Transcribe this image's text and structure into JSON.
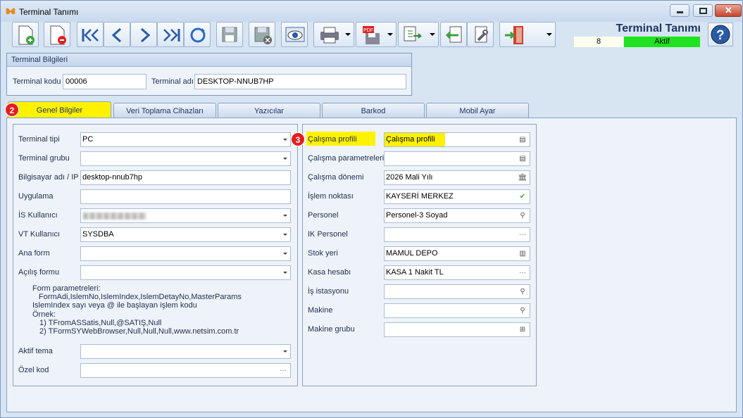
{
  "window": {
    "title": "Terminal Tanımı"
  },
  "header": {
    "title": "Terminal Tanımı",
    "record_number": "8",
    "status": "Aktif",
    "status_color": "#1ee31e"
  },
  "toolbar": {
    "buttons": [
      "new-document-icon",
      "delete-document-icon",
      "first-record-icon",
      "previous-record-icon",
      "next-record-icon",
      "last-record-icon",
      "refresh-icon",
      "save-icon",
      "cancel-save-icon",
      "preview-icon",
      "print-icon",
      "pdf-export-icon",
      "export-icon",
      "import-icon",
      "tools-icon",
      "exit-door-icon",
      "help-icon"
    ]
  },
  "terminal_info": {
    "title": "Terminal Bilgileri",
    "code_label": "Terminal kodu",
    "code_value": "00006",
    "name_label": "Terminal adı",
    "name_value": "DESKTOP-NNUB7HP"
  },
  "tabs": [
    "Genel Bilgiler",
    "Veri Toplama Cihazları",
    "Yazıcılar",
    "Barkod",
    "Mobil Ayar"
  ],
  "badges": {
    "tab": "2",
    "profile": "3"
  },
  "left": {
    "fields": [
      {
        "label": "Terminal tipi",
        "value": "PC"
      },
      {
        "label": "Terminal grubu",
        "value": ""
      },
      {
        "label": "Bilgisayar adı / IP",
        "value": "desktop-nnub7hp"
      },
      {
        "label": "Uygulama",
        "value": ""
      },
      {
        "label": "İS Kullanıcı",
        "value": ""
      },
      {
        "label": "VT Kullanıcı",
        "value": "SYSDBA"
      },
      {
        "label": "Ana form",
        "value": ""
      },
      {
        "label": "Açılış formu",
        "value": ""
      },
      {
        "label": "Aktif tema",
        "value": ""
      },
      {
        "label": "Özel kod",
        "value": ""
      }
    ],
    "note_lines": [
      "Form parametreleri:",
      "FormAdi,IslemNo,IslemIndex,IslemDetayNo,MasterParams",
      "IslemIndex sayı veya @ ile başlayan işlem kodu",
      "Örnek:",
      "1) TFromASSatis,Null,@SATIŞ,Null",
      "2) TFormSYWebBrowser,Null,Null,Null,www.netsim.com.tr"
    ]
  },
  "right": {
    "fields": [
      {
        "label": "Çalışma profili",
        "value": "Çalışma profili"
      },
      {
        "label": "Çalışma parametreleri",
        "value": ""
      },
      {
        "label": "Çalışma dönemi",
        "value": "2026 Mali Yılı"
      },
      {
        "label": "İşlem noktası",
        "value": "KAYSERİ MERKEZ"
      },
      {
        "label": "Personel",
        "value": "Personel-3 Soyad"
      },
      {
        "label": "IK Personel",
        "value": ""
      },
      {
        "label": "Stok yeri",
        "value": "MAMUL DEPO"
      },
      {
        "label": "Kasa hesabı",
        "value": "KASA 1 Nakit TL"
      },
      {
        "label": "İş istasyonu",
        "value": ""
      },
      {
        "label": "Makine",
        "value": ""
      },
      {
        "label": "Makine grubu",
        "value": ""
      }
    ]
  }
}
